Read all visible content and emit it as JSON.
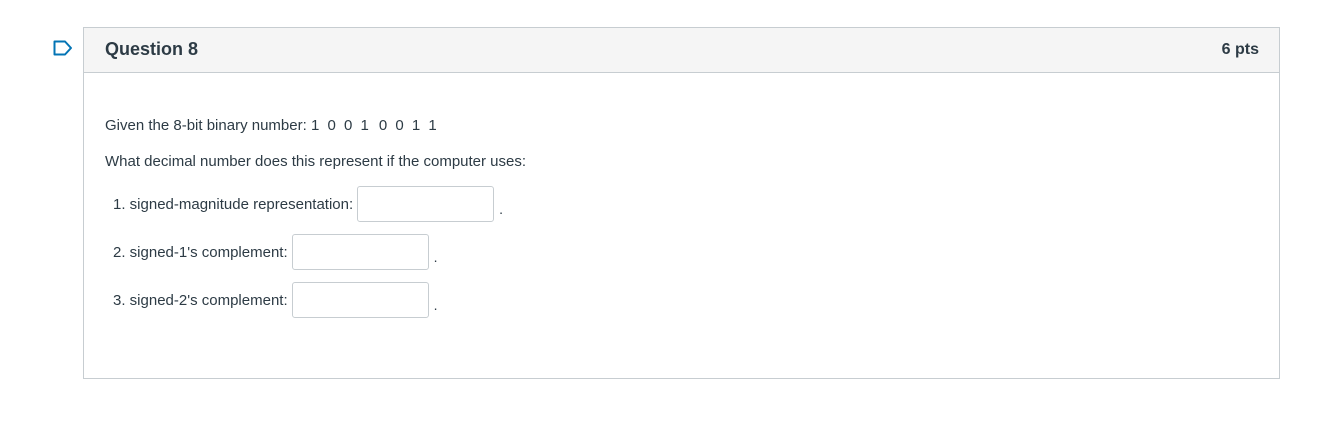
{
  "question": {
    "title": "Question 8",
    "points": "6 pts",
    "given_prefix": "Given the 8-bit binary number:",
    "binary_first": "1 0 0 1",
    "binary_second": "0 0 1 1",
    "prompt": "What decimal number does this represent if the computer uses:",
    "answers": [
      {
        "label": "1. signed-magnitude representation:",
        "value": "",
        "suffix": "."
      },
      {
        "label": "2. signed-1's complement:",
        "value": "",
        "suffix": "."
      },
      {
        "label": "3. signed-2's complement:",
        "value": "",
        "suffix": "."
      }
    ]
  },
  "colors": {
    "header_bg": "#f5f5f5",
    "border": "#c7cdd1",
    "flag": "#0374b5",
    "text": "#2d3b45"
  },
  "icons": {
    "flag": "bookmark-flag-icon"
  }
}
